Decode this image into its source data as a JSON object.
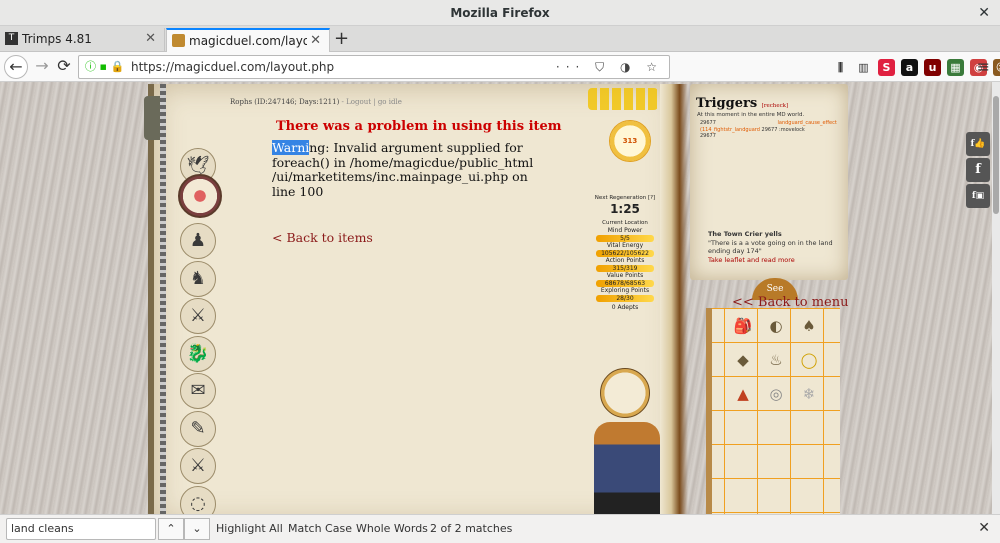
{
  "window": {
    "title": "Mozilla Firefox",
    "close_glyph": "✕"
  },
  "tabs": [
    {
      "label": "Trimps 4.81",
      "icon": "trimps-tab-icon"
    },
    {
      "label": "magicduel.com/layout.php",
      "icon": "magicduel-tab-icon"
    }
  ],
  "newtab_glyph": "+",
  "nav": {
    "back": "←",
    "forward": "→",
    "reload": "⟳",
    "url": "https://magicduel.com/layout.php",
    "url_actions": "··· ⛉ ◑ ☆"
  },
  "toolbar_icons": [
    {
      "name": "library-icon",
      "glyph": "⫼",
      "color": "#333333"
    },
    {
      "name": "sidebar-icon",
      "glyph": "▥",
      "color": "#333333"
    },
    {
      "name": "stylus-icon",
      "glyph": "S",
      "color": "#e02040"
    },
    {
      "name": "a-extension-icon",
      "glyph": "a",
      "color": "#111111"
    },
    {
      "name": "ublock-icon",
      "glyph": "u",
      "color": "#800000"
    },
    {
      "name": "image-extension-icon",
      "glyph": "▦",
      "color": "#3a7a3a"
    },
    {
      "name": "chrome-extension-icon",
      "glyph": "◉",
      "color": "#d04040"
    },
    {
      "name": "monkey-icon",
      "glyph": "☺",
      "color": "#8a5a20"
    }
  ],
  "menu_glyph": "≡",
  "game": {
    "user_line": "Rophs (ID:247146; Days:1211)",
    "user_links": "Logout | go idle",
    "error_title": "There was a problem in using this item",
    "warning_highlight": "Warni",
    "warning_rest": "ng: Invalid argument supplied for foreach() in /home/magicdue/public_html /ui/marketitems/inc.mainpage_ui.php on line 100",
    "back_items": "< Back to items",
    "sun_value": "313",
    "next_regen_label": "Next Regeneration [?]",
    "next_regen_time": "1:25",
    "current_location": "Current Location",
    "stats": [
      {
        "label": "Mind Power",
        "value": "5/5"
      },
      {
        "label": "Vital Energy",
        "value": "105622/105622"
      },
      {
        "label": "Action Points",
        "value": "315/319"
      },
      {
        "label": "Value Points",
        "value": "68678/68563"
      },
      {
        "label": "Exploring Points",
        "value": "28/30"
      }
    ],
    "adepts": "0 Adepts",
    "side_icons": [
      "bird-icon",
      "compass-icon",
      "players-icon",
      "beast-icon",
      "crossed-swords-shield-icon",
      "dragon-icon",
      "envelope-icon",
      "scroll-icon",
      "crossed-swords-icon",
      "bottom-icon"
    ],
    "side_glyphs": [
      "🕊",
      "✷",
      "♟",
      "♞",
      "⚔",
      "🐉",
      "✉",
      "✎",
      "⚔",
      "◌"
    ]
  },
  "triggers": {
    "title": "Triggers",
    "recheck": "[recheck]",
    "subtitle": "At this moment in the entire MD world.",
    "rows": [
      {
        "id": "29677",
        "text": "landguard_cause_effect"
      },
      {
        "id": "(114_fightstr_landguard",
        "text": "29677 :movelock"
      },
      {
        "id": "29677",
        "text": ""
      }
    ],
    "crier_title": "The Town Crier yells",
    "crier_text": "\"There is a a vote going on in the land ending day 174\"",
    "crier_link": "Take leaflet and read more",
    "see": "See",
    "back_menu": "<< Back to menu"
  },
  "inventory": [
    {
      "name": "green-bag-icon",
      "glyph": "🎒"
    },
    {
      "name": "shell-icon",
      "glyph": "◐"
    },
    {
      "name": "acorn-icon",
      "glyph": "♠"
    },
    {
      "name": "pouch-icon",
      "glyph": "◆"
    },
    {
      "name": "feather-icon",
      "glyph": "♨"
    },
    {
      "name": "gold-ring-icon",
      "glyph": "◯"
    },
    {
      "name": "cake-icon",
      "glyph": "▲"
    },
    {
      "name": "silver-ring-icon",
      "glyph": "◎"
    },
    {
      "name": "snowflake-icon",
      "glyph": "❄"
    }
  ],
  "social": [
    "f👍",
    "f",
    "f▣"
  ],
  "findbar": {
    "query": "land cleans",
    "up": "⌃",
    "down": "⌄",
    "highlight_all": "Highlight All",
    "match_case": "Match Case",
    "whole_words": "Whole Words",
    "status": "2 of 2 matches",
    "close": "✕"
  }
}
